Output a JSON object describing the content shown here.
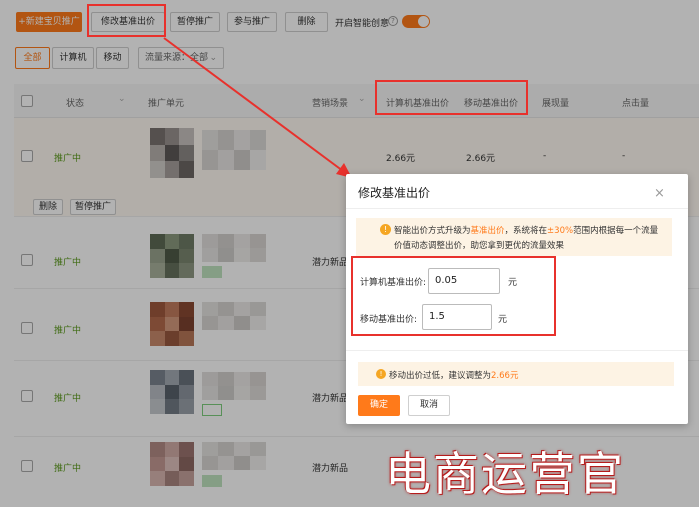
{
  "toolbar": {
    "new_label": "+新建宝贝推广",
    "modify_bid_label": "修改基准出价",
    "pause_label": "暂停推广",
    "join_label": "参与推广",
    "delete_label": "删除",
    "smart_creative_label": "开启智能创意"
  },
  "filters": {
    "all": "全部",
    "computer": "计算机",
    "mobile": "移动",
    "traffic_source": "流量来源：全部"
  },
  "table": {
    "headers": {
      "status": "状态",
      "unit": "推广单元",
      "scene": "营销场景",
      "pc_bid": "计算机基准出价",
      "mobile_bid": "移动基准出价",
      "impressions": "展现量",
      "clicks": "点击量"
    },
    "row1": {
      "status": "推广中",
      "pc_bid": "2.66元",
      "mobile_bid": "2.66元",
      "impressions": "-",
      "clicks": "-",
      "delete": "删除",
      "pause": "暂停推广"
    },
    "rows": [
      {
        "status": "推广中",
        "scene": "潜力新品"
      },
      {
        "status": "推广中",
        "scene": ""
      },
      {
        "status": "推广中",
        "scene": "潜力新品"
      },
      {
        "status": "推广中",
        "scene": "潜力新品"
      }
    ]
  },
  "modal": {
    "title": "修改基准出价",
    "notice_pre": "智能出价方式升级为",
    "notice_link": "基准出价",
    "notice_mid": "，系统将在",
    "notice_range": "±30%",
    "notice_post": "范围内根据每一个流量",
    "notice_line2": "价值动态调整出价，助您拿到更优的流量效果",
    "pc_label": "计算机基准出价:",
    "pc_value": "0.05",
    "mobile_label": "移动基准出价:",
    "mobile_value": "1.5",
    "unit": "元",
    "warn_pre": "移动出价过低，建议调整为",
    "warn_value": "2.66元",
    "ok": "确定",
    "cancel": "取消"
  },
  "watermark": "电商运营官",
  "colors": {
    "accent": "#ff7a1a",
    "highlight": "#e8312c",
    "status_green": "#5a9a1a"
  }
}
